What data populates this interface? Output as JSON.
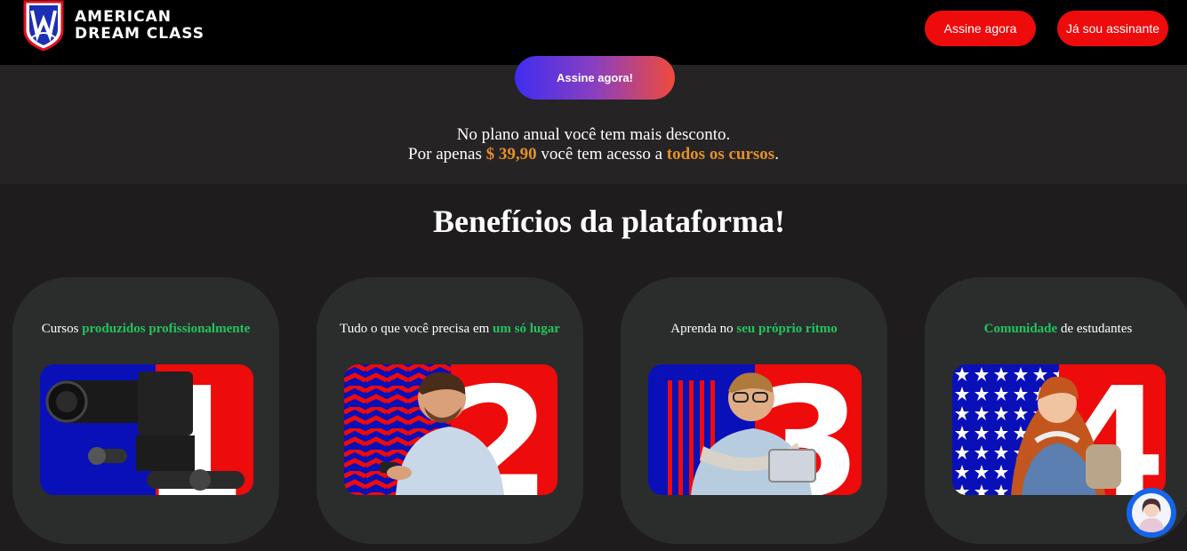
{
  "header": {
    "logo_line1": "AMERICAN",
    "logo_line2": "DREAM CLASS",
    "logo_icon": "shield-icon",
    "subscribe_label": "Assine agora",
    "subscriber_label": "Já sou assinante"
  },
  "offer": {
    "cta_label": "Assine agora!",
    "line1": "No plano anual você tem mais desconto.",
    "line2_pre": "Por apenas ",
    "price": "$ 39,90",
    "line2_mid": " você tem acesso a ",
    "all_courses": "todos os cursos",
    "line2_end": "."
  },
  "benefits": {
    "title": "Benefícios da plataforma!",
    "cards": [
      {
        "pre": "Cursos ",
        "highlight": "produzidos profissionalmente",
        "post": "",
        "number": "1"
      },
      {
        "pre": "Tudo o que você precisa em ",
        "highlight": "um só lugar",
        "post": "",
        "number": "2"
      },
      {
        "pre": "Aprenda no ",
        "highlight": "seu próprio ritmo",
        "post": "",
        "number": "3"
      },
      {
        "pre": "",
        "highlight": "Comunidade",
        "post": " de estudantes",
        "number": "4"
      }
    ]
  },
  "chat": {
    "icon": "chat-assistant-icon"
  },
  "colors": {
    "red": "#ee0b0b",
    "blue": "#0a10b8",
    "green": "#23c45c",
    "orange": "#e3902a",
    "card_bg": "#2b2d2d"
  }
}
